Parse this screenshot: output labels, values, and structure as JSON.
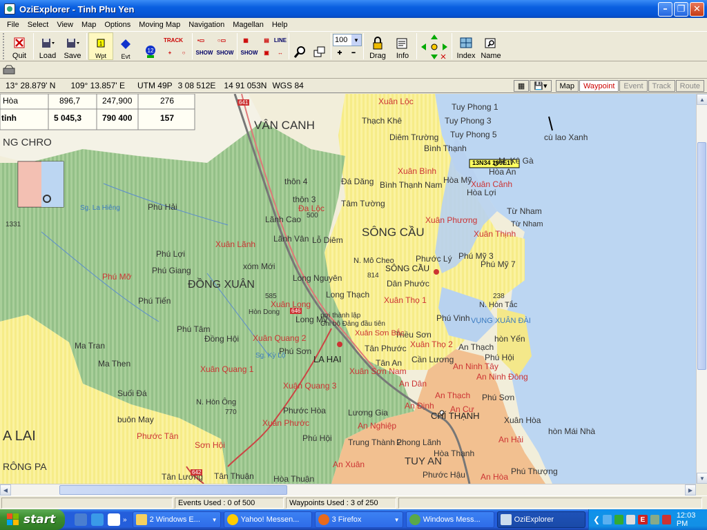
{
  "window": {
    "title": "OziExplorer - Tinh Phu Yen"
  },
  "menu": [
    "File",
    "Select",
    "View",
    "Map",
    "Options",
    "Moving Map",
    "Navigation",
    "Magellan",
    "Help"
  ],
  "toolbar": {
    "quit": "Quit",
    "load": "Load",
    "save": "Save",
    "wpt": "Wpt",
    "evt": "Evt",
    "track": "TRACK",
    "show": "SHOW",
    "line": "LINE",
    "zoom": "100",
    "drag": "Drag",
    "info": "Info",
    "index": "Index",
    "name": "Name",
    "wpt_count": "12"
  },
  "coords": {
    "lat": "13° 28.879' N",
    "lon": "109° 13.857' E",
    "utm": "UTM  49P",
    "easting": "3 08 512E",
    "northing": "14 91 053N",
    "datum": "WGS 84"
  },
  "modes": [
    "Map",
    "Waypoint",
    "Event",
    "Track",
    "Route"
  ],
  "table": [
    [
      "Hòa",
      "896,7",
      "247,900",
      "276"
    ],
    [
      "tỉnh",
      "5 045,3",
      "790 400",
      "157"
    ]
  ],
  "waypoint_tag": "13N34 109E17",
  "map_labels": [
    {
      "t": "VÂN CANH",
      "c": "#333",
      "s": 17
    },
    {
      "t": "NG CHRO",
      "c": "#333",
      "s": 15
    },
    {
      "t": "SÔNG CẦU",
      "c": "#333",
      "s": 17
    },
    {
      "t": "ĐỒNG XUÂN",
      "c": "#333",
      "s": 16
    },
    {
      "t": "A  LAI",
      "c": "#333",
      "s": 20
    },
    {
      "t": "RÔNG PA",
      "c": "#333",
      "s": 14
    },
    {
      "t": "CHÍ THẠNH",
      "c": "#222",
      "s": 13
    },
    {
      "t": "TUY AN",
      "c": "#333",
      "s": 15
    },
    {
      "t": "LA HAI",
      "c": "#222",
      "s": 13
    },
    {
      "t": "SÔNG CẦU",
      "c": "#222",
      "s": 12
    },
    {
      "t": "Xuân Lộc",
      "c": "#c33",
      "s": 12
    },
    {
      "t": "Tuy Phong 1",
      "c": "#333",
      "s": 12
    },
    {
      "t": "Tuy Phong 3",
      "c": "#333",
      "s": 12
    },
    {
      "t": "Tuy Phong 5",
      "c": "#333",
      "s": 12
    },
    {
      "t": "Thạch Khê",
      "c": "#333",
      "s": 12
    },
    {
      "t": "Diêm Trường",
      "c": "#333",
      "s": 12
    },
    {
      "t": "Bình Thạnh",
      "c": "#333",
      "s": 12
    },
    {
      "t": "Xuân Bình",
      "c": "#c33",
      "s": 12
    },
    {
      "t": "Xuân Cảnh",
      "c": "#c33",
      "s": 12
    },
    {
      "t": "M. Kê Gà",
      "c": "#333",
      "s": 12
    },
    {
      "t": "Hòa An",
      "c": "#333",
      "s": 12
    },
    {
      "t": "Hòa Mỹ",
      "c": "#333",
      "s": 12
    },
    {
      "t": "Hòa Lợi",
      "c": "#333",
      "s": 12
    },
    {
      "t": "Đá Dăng",
      "c": "#333",
      "s": 12
    },
    {
      "t": "Bình Thạnh Nam",
      "c": "#333",
      "s": 12
    },
    {
      "t": "Tâm Tường",
      "c": "#333",
      "s": 12
    },
    {
      "t": "cù lao Xanh",
      "c": "#333",
      "s": 12
    },
    {
      "t": "Từ Nham",
      "c": "#333",
      "s": 12
    },
    {
      "t": "Xuân Phương",
      "c": "#c33",
      "s": 12
    },
    {
      "t": "Xuân Thịnh",
      "c": "#c33",
      "s": 12
    },
    {
      "t": "Phước Lý",
      "c": "#333",
      "s": 12
    },
    {
      "t": "Phú Mỹ 3",
      "c": "#333",
      "s": 12
    },
    {
      "t": "Phú Mỹ 7",
      "c": "#333",
      "s": 12
    },
    {
      "t": "Dân Phước",
      "c": "#333",
      "s": 12
    },
    {
      "t": "Xuân Thọ 1",
      "c": "#c33",
      "s": 12
    },
    {
      "t": "N. Hòn Tắc",
      "c": "#333",
      "s": 11
    },
    {
      "t": "VỤNG XUÂN ĐÀI",
      "c": "#3a7ac0",
      "s": 11
    },
    {
      "t": "Phú Vinh",
      "c": "#333",
      "s": 12
    },
    {
      "t": "hòn Yến",
      "c": "#333",
      "s": 12
    },
    {
      "t": "Xuân Thọ 2",
      "c": "#c33",
      "s": 12
    },
    {
      "t": "An Thạch",
      "c": "#333",
      "s": 12
    },
    {
      "t": "Triều Sơn",
      "c": "#333",
      "s": 12
    },
    {
      "t": "Phú Hội",
      "c": "#333",
      "s": 12
    },
    {
      "t": "An Ninh Tây",
      "c": "#c33",
      "s": 12
    },
    {
      "t": "An Ninh Đông",
      "c": "#c33",
      "s": 12
    },
    {
      "t": "Phú Sơn",
      "c": "#333",
      "s": 12
    },
    {
      "t": "An Thạch",
      "c": "#c33",
      "s": 12
    },
    {
      "t": "An Cư",
      "c": "#c33",
      "s": 12
    },
    {
      "t": "Xuân Hòa",
      "c": "#333",
      "s": 12
    },
    {
      "t": "hòn Mái Nhà",
      "c": "#333",
      "s": 12
    },
    {
      "t": "An Hải",
      "c": "#c33",
      "s": 12
    },
    {
      "t": "Phú Thượng",
      "c": "#333",
      "s": 12
    },
    {
      "t": "An Hòa",
      "c": "#c33",
      "s": 12
    },
    {
      "t": "Phước Hậu",
      "c": "#333",
      "s": 12
    },
    {
      "t": "An Xuân",
      "c": "#c33",
      "s": 12
    },
    {
      "t": "Trung Thành 2",
      "c": "#333",
      "s": 12
    },
    {
      "t": "Phong Lãnh",
      "c": "#333",
      "s": 12
    },
    {
      "t": "Hòa Thạnh",
      "c": "#333",
      "s": 12
    },
    {
      "t": "An Nghiệp",
      "c": "#c33",
      "s": 12
    },
    {
      "t": "Lương Gia",
      "c": "#333",
      "s": 12
    },
    {
      "t": "An Định",
      "c": "#c33",
      "s": 12
    },
    {
      "t": "An Dân",
      "c": "#c33",
      "s": 12
    },
    {
      "t": "Cần Lương",
      "c": "#333",
      "s": 12
    },
    {
      "t": "Tân An",
      "c": "#333",
      "s": 12
    },
    {
      "t": "Xuân Sơn Nam",
      "c": "#c33",
      "s": 12
    },
    {
      "t": "Xuân Sơn Bắc",
      "c": "#c33",
      "s": 11
    },
    {
      "t": "Tân Phước",
      "c": "#333",
      "s": 12
    },
    {
      "t": "Long Thạch",
      "c": "#333",
      "s": 12
    },
    {
      "t": "Long Mỹ",
      "c": "#333",
      "s": 12
    },
    {
      "t": "nơi thành lập",
      "c": "#333",
      "s": 10
    },
    {
      "t": "Chi bộ Đảng đầu tiên",
      "c": "#333",
      "s": 10
    },
    {
      "t": "Long Nguyên",
      "c": "#333",
      "s": 12
    },
    {
      "t": "N. Mô Cheo",
      "c": "#333",
      "s": 11
    },
    {
      "t": "814",
      "c": "#333",
      "s": 10
    },
    {
      "t": "Lỗ Diêm",
      "c": "#333",
      "s": 12
    },
    {
      "t": "thôn 4",
      "c": "#333",
      "s": 12
    },
    {
      "t": "thôn 3",
      "c": "#333",
      "s": 12
    },
    {
      "t": "Đa Lộc",
      "c": "#c33",
      "s": 12
    },
    {
      "t": "500",
      "c": "#333",
      "s": 10
    },
    {
      "t": "Lãnh Cao",
      "c": "#333",
      "s": 12
    },
    {
      "t": "Lãnh Vân",
      "c": "#333",
      "s": 12
    },
    {
      "t": "Xuân Lãnh",
      "c": "#c33",
      "s": 12
    },
    {
      "t": "xóm Mới",
      "c": "#333",
      "s": 12
    },
    {
      "t": "Phú Hải",
      "c": "#333",
      "s": 12
    },
    {
      "t": "1331",
      "c": "#333",
      "s": 10
    },
    {
      "t": "Phú Lợi",
      "c": "#333",
      "s": 12
    },
    {
      "t": "Phú Giang",
      "c": "#333",
      "s": 12
    },
    {
      "t": "Phú Mỡ",
      "c": "#c33",
      "s": 12
    },
    {
      "t": "Phú Tiến",
      "c": "#333",
      "s": 12
    },
    {
      "t": "585",
      "c": "#333",
      "s": 10
    },
    {
      "t": "Xuân Long",
      "c": "#c33",
      "s": 12
    },
    {
      "t": "Hòn Dong",
      "c": "#333",
      "s": 10
    },
    {
      "t": "Phú Tâm",
      "c": "#333",
      "s": 12
    },
    {
      "t": "Đồng Hội",
      "c": "#333",
      "s": 12
    },
    {
      "t": "Xuân Quang 2",
      "c": "#c33",
      "s": 12
    },
    {
      "t": "Phú Sơn",
      "c": "#333",
      "s": 12
    },
    {
      "t": "Xuân Quang 1",
      "c": "#c33",
      "s": 12
    },
    {
      "t": "Xuân Quang 3",
      "c": "#c33",
      "s": 12
    },
    {
      "t": "Ma Tran",
      "c": "#333",
      "s": 12
    },
    {
      "t": "Ma Then",
      "c": "#333",
      "s": 12
    },
    {
      "t": "Suối Đá",
      "c": "#333",
      "s": 12
    },
    {
      "t": "buôn May",
      "c": "#333",
      "s": 12
    },
    {
      "t": "N. Hòn Ông",
      "c": "#333",
      "s": 11
    },
    {
      "t": "770",
      "c": "#333",
      "s": 10
    },
    {
      "t": "Phước Tân",
      "c": "#c33",
      "s": 12
    },
    {
      "t": "Sơn Hội",
      "c": "#c33",
      "s": 12
    },
    {
      "t": "Xuân Phước",
      "c": "#c33",
      "s": 12
    },
    {
      "t": "Phước Hòa",
      "c": "#333",
      "s": 12
    },
    {
      "t": "Phú Hội",
      "c": "#333",
      "s": 12
    },
    {
      "t": "Tân Lương",
      "c": "#333",
      "s": 12
    },
    {
      "t": "Tân Thuận",
      "c": "#333",
      "s": 12
    },
    {
      "t": "Hòa Thuận",
      "c": "#333",
      "s": 12
    },
    {
      "t": "641",
      "c": "#fff",
      "s": 8
    },
    {
      "t": "646",
      "c": "#fff",
      "s": 8
    },
    {
      "t": "642",
      "c": "#fff",
      "s": 8
    },
    {
      "t": "Sg. Kỳ Lộ",
      "c": "#3a7ac0",
      "s": 10
    },
    {
      "t": "Sg. La Hiêng",
      "c": "#3a7ac0",
      "s": 10
    },
    {
      "t": "238",
      "c": "#333",
      "s": 10
    },
    {
      "t": "Từ Nham",
      "c": "#333",
      "s": 11
    }
  ],
  "status": {
    "events": "Events Used : 0 of 500",
    "waypoints": "Waypoints Used : 3 of 250"
  },
  "taskbar": {
    "start": "start",
    "tasks": [
      "2 Windows E...",
      "Yahoo! Messen...",
      "3 Firefox",
      "Windows Mess...",
      "OziExplorer"
    ],
    "clock": "12:03 PM"
  }
}
